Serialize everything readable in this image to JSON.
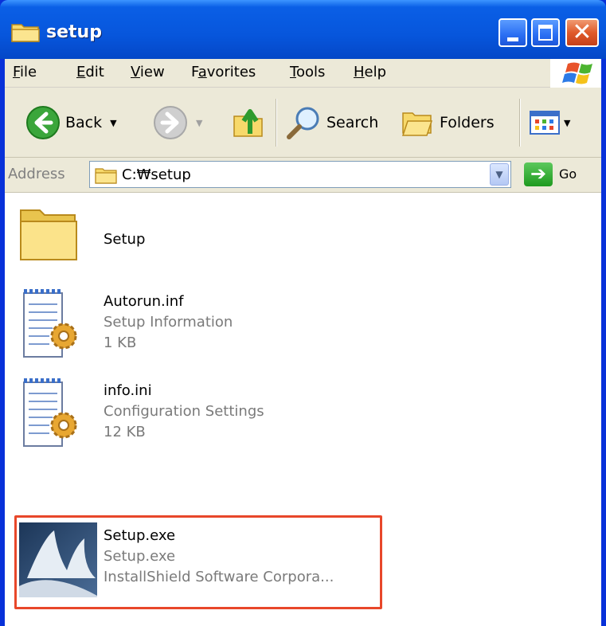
{
  "window": {
    "title": "setup"
  },
  "menu": {
    "items": [
      {
        "label": "File",
        "key": "F",
        "rest": "ile"
      },
      {
        "label": "Edit",
        "key": "E",
        "rest": "dit"
      },
      {
        "label": "View",
        "key": "V",
        "rest": "iew"
      },
      {
        "label": "Favorites",
        "pre": "F",
        "key": "a",
        "rest": "vorites"
      },
      {
        "label": "Tools",
        "key": "T",
        "rest": "ools"
      },
      {
        "label": "Help",
        "key": "H",
        "rest": "elp"
      }
    ]
  },
  "toolbar": {
    "back_label": "Back",
    "search_label": "Search",
    "folders_label": "Folders"
  },
  "address": {
    "label": "Address",
    "value": "C:₩setup",
    "go_label": "Go"
  },
  "files": [
    {
      "name": "Setup",
      "type": "",
      "size": "",
      "icon": "folder-icon"
    },
    {
      "name": "Autorun.inf",
      "type": "Setup Information",
      "size": "1 KB",
      "icon": "setup-information-icon"
    },
    {
      "name": "info.ini",
      "type": "Configuration Settings",
      "size": "12 KB",
      "icon": "configuration-settings-icon"
    },
    {
      "name": "Setup.exe",
      "type": "Setup.exe",
      "size": "InstallShield Software Corpora...",
      "icon": "installshield-icon"
    }
  ],
  "colors": {
    "titlebar": "#0756dc",
    "highlight": "#e8472a",
    "chrome": "#ece9d8"
  }
}
